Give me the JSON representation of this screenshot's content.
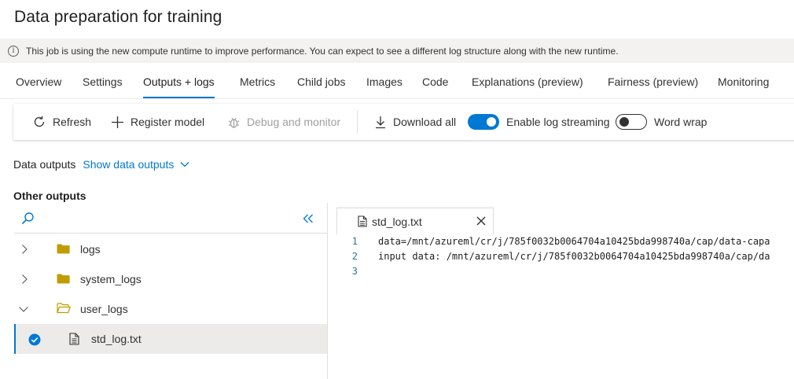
{
  "page": {
    "title": "Data preparation for training"
  },
  "info": {
    "message": "This job is using the new compute runtime to improve performance. You can expect to see a different log structure along with the new runtime."
  },
  "tabs": [
    {
      "label": "Overview"
    },
    {
      "label": "Settings"
    },
    {
      "label": "Outputs + logs"
    },
    {
      "label": "Metrics"
    },
    {
      "label": "Child jobs"
    },
    {
      "label": "Images"
    },
    {
      "label": "Code"
    },
    {
      "label": "Explanations (preview)"
    },
    {
      "label": "Fairness (preview)"
    },
    {
      "label": "Monitoring"
    }
  ],
  "active_tab": "Outputs + logs",
  "toolbar": {
    "refresh": "Refresh",
    "register_model": "Register model",
    "debug_monitor": "Debug and monitor",
    "download_all": "Download all",
    "log_streaming": "Enable log streaming",
    "log_streaming_on": true,
    "word_wrap": "Word wrap",
    "word_wrap_on": false
  },
  "data_outputs": {
    "label": "Data outputs",
    "link": "Show data outputs"
  },
  "other_outputs": {
    "label": "Other outputs"
  },
  "tree": {
    "items": [
      {
        "name": "logs",
        "type": "folder",
        "expanded": false
      },
      {
        "name": "system_logs",
        "type": "folder",
        "expanded": false
      },
      {
        "name": "user_logs",
        "type": "folder",
        "expanded": true
      },
      {
        "name": "std_log.txt",
        "type": "file",
        "selected": true
      }
    ]
  },
  "editor": {
    "tab_name": "std_log.txt",
    "lines": [
      {
        "num": "1",
        "text": "data=/mnt/azureml/cr/j/785f0032b0064704a10425bda998740a/cap/data-capa"
      },
      {
        "num": "2",
        "text": "input data: /mnt/azureml/cr/j/785f0032b0064704a10425bda998740a/cap/da"
      },
      {
        "num": "3",
        "text": ""
      }
    ]
  },
  "colors": {
    "accent": "#0078d4",
    "folder": "#c19c00"
  }
}
